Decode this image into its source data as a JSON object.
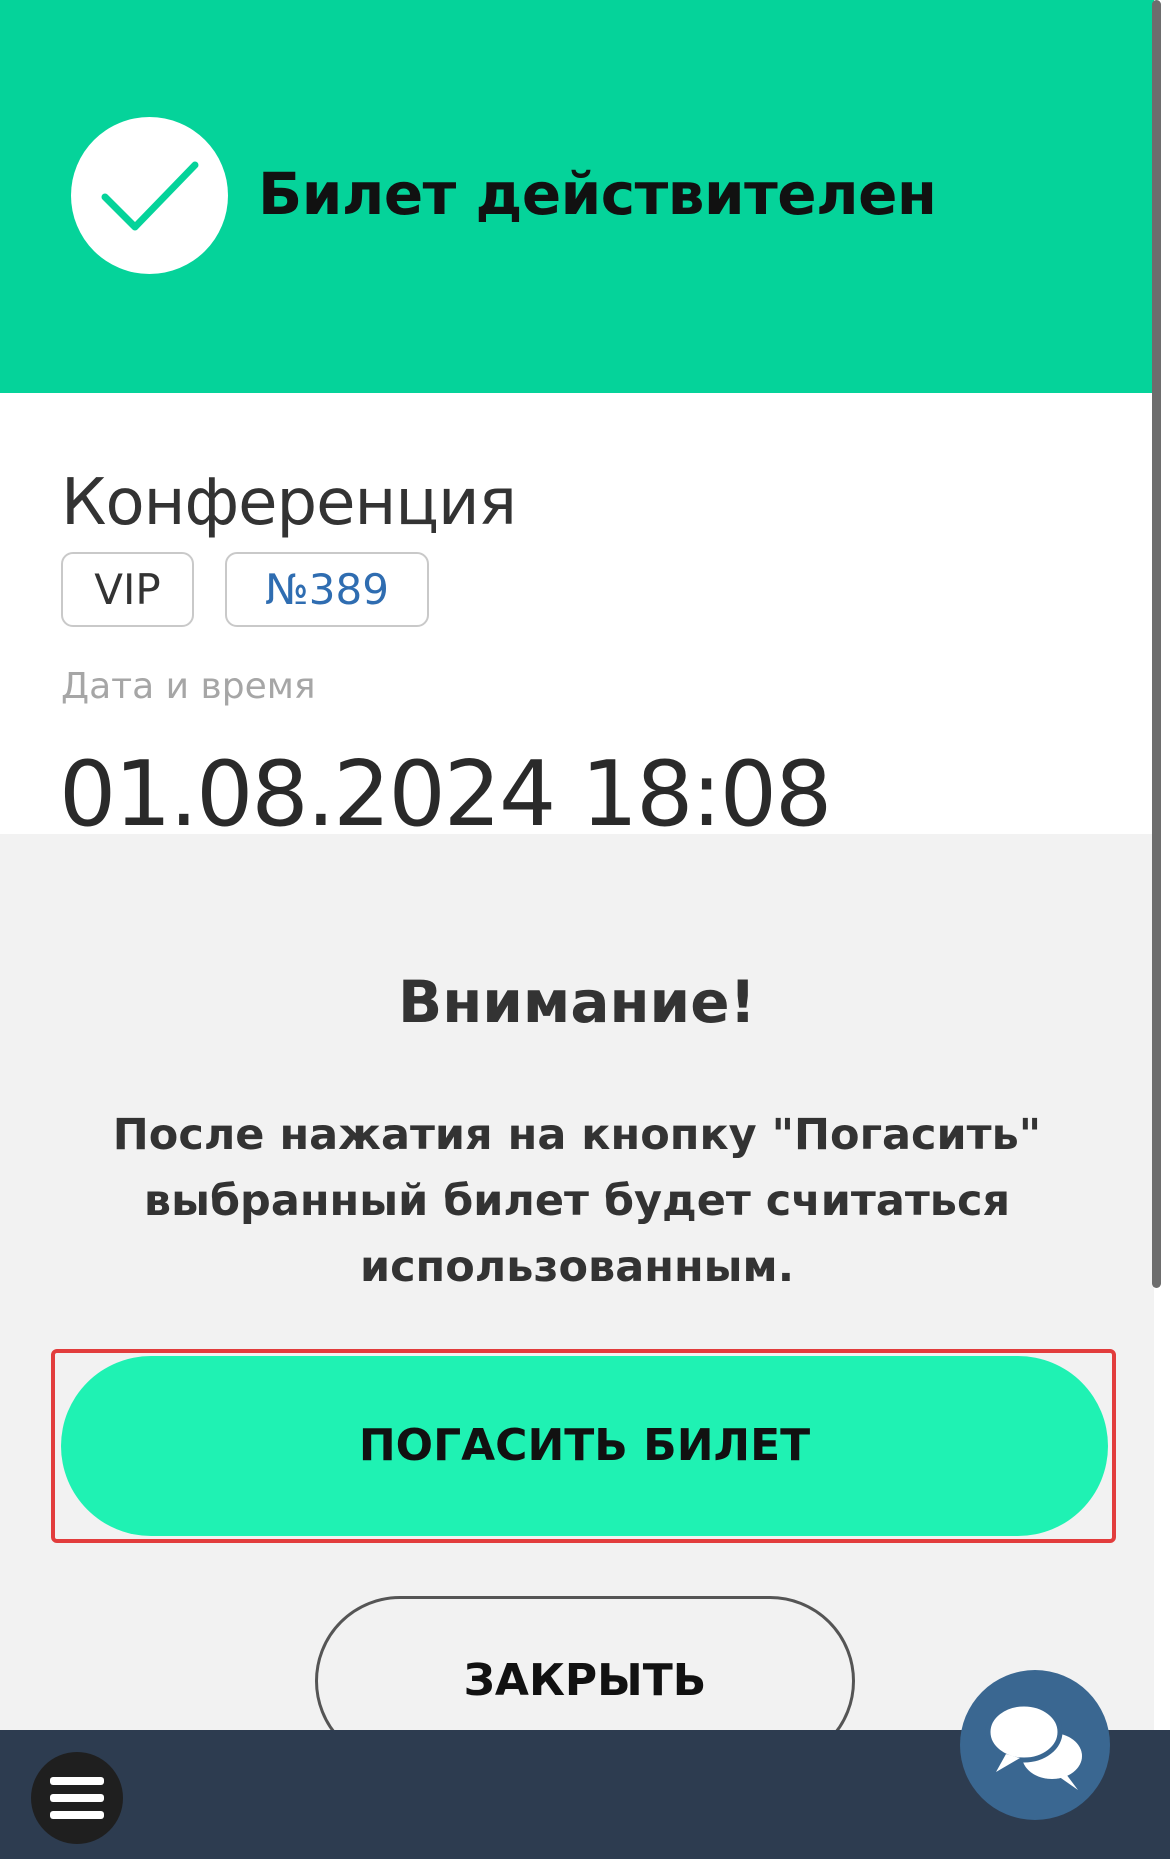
{
  "header": {
    "status_title": "Билет действителен",
    "status_icon": "checkmark-icon",
    "background_color": "#05d39a"
  },
  "ticket": {
    "event_name": "Конференция",
    "category": "VIP",
    "number": "№389",
    "date_label": "Дата и время",
    "date_value": "01.08.2024 18:08"
  },
  "modal": {
    "title": "Внимание!",
    "message": "После нажатия на кнопку \"Погасить\" выбранный билет будет считаться использованным.",
    "redeem_button_label": "ПОГАСИТЬ БИЛЕТ",
    "close_button_label": "ЗАКРЫТЬ",
    "redeem_button_color": "#1ff2b3",
    "highlight_color": "#e23d3d"
  },
  "bottom_bar": {
    "menu_icon": "hamburger-menu-icon",
    "chat_icon": "chat-bubbles-icon",
    "background_color": "#2d3c50"
  }
}
